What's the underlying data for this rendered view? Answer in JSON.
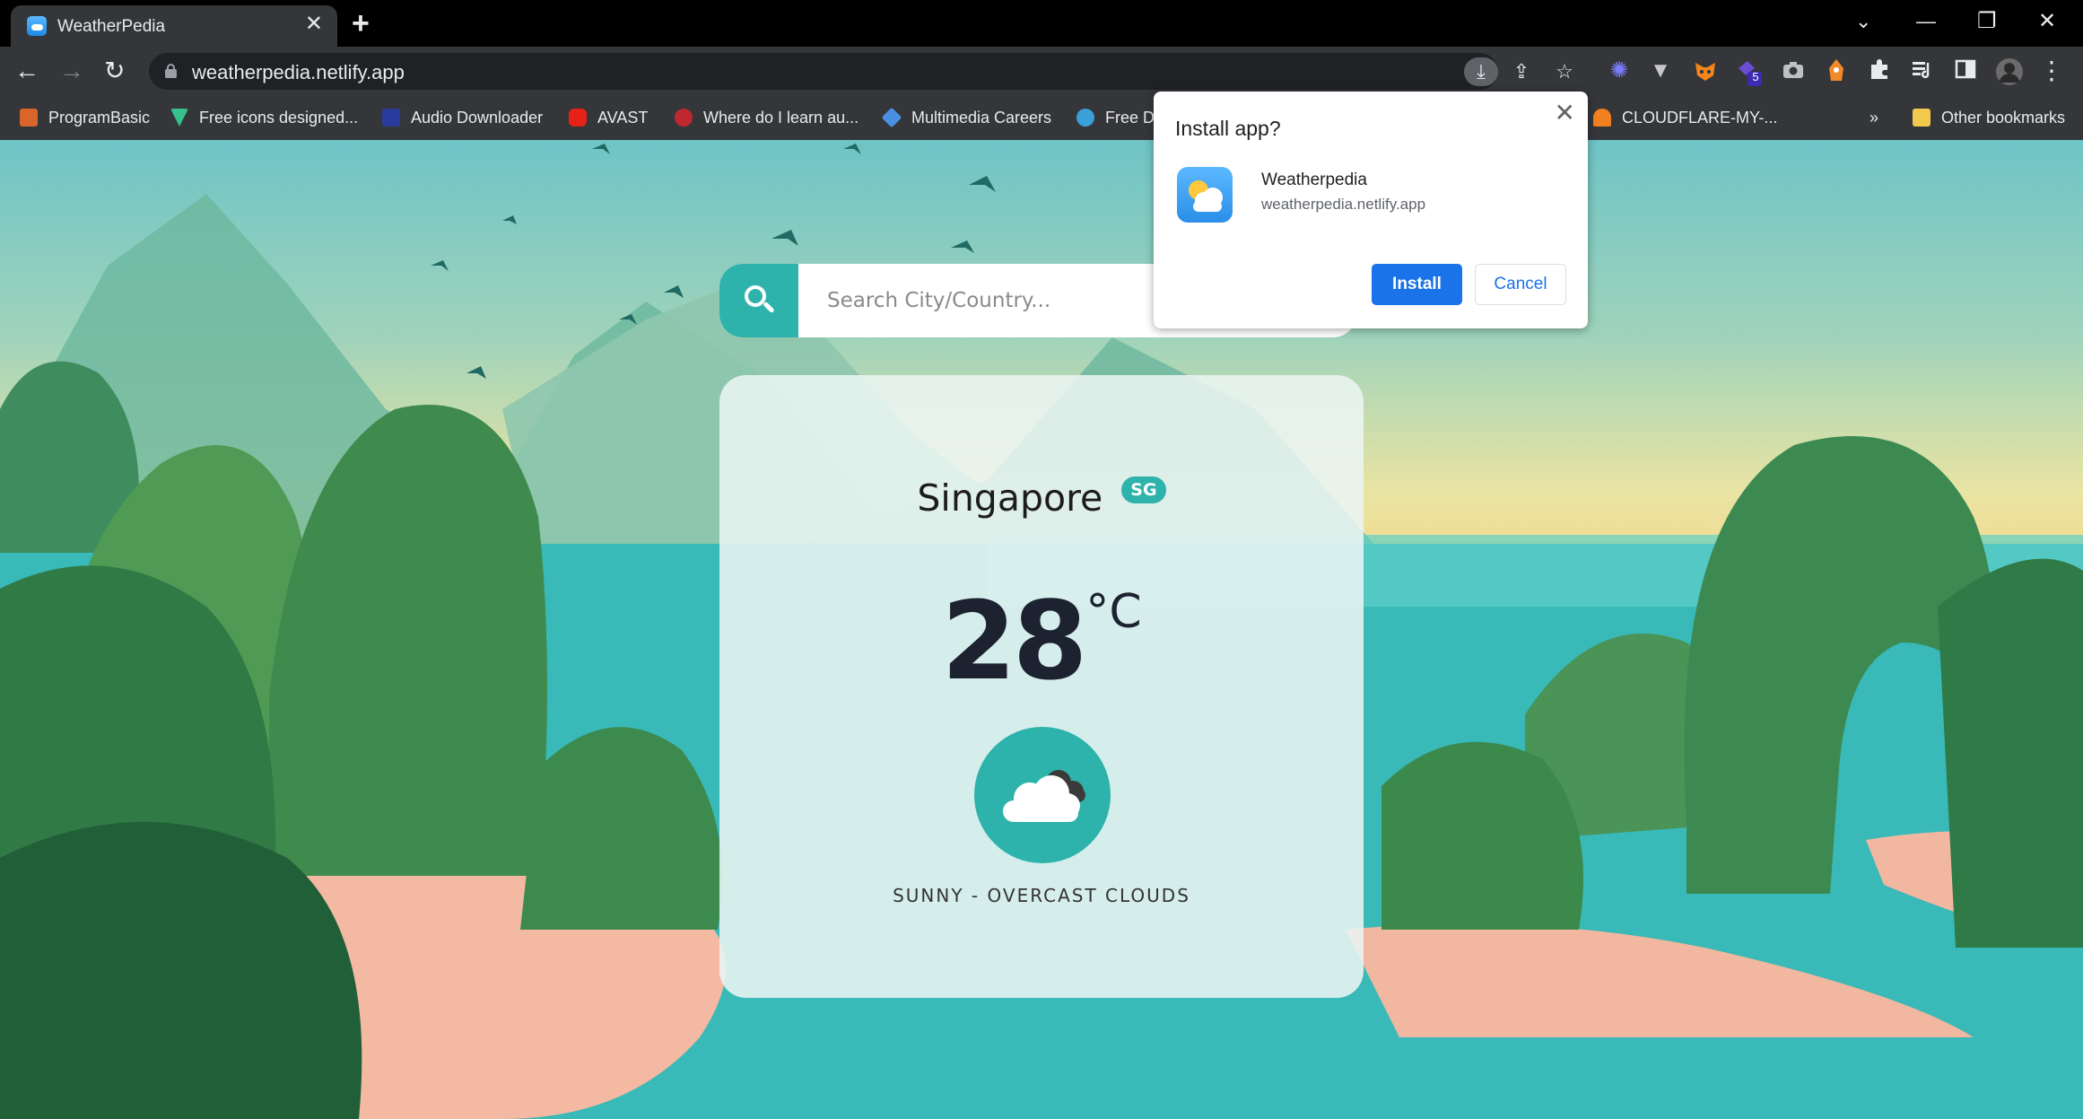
{
  "browser": {
    "tab": {
      "title": "WeatherPedia",
      "close_glyph": "✕"
    },
    "new_tab_glyph": "+",
    "window_controls": {
      "tablist": "⌄",
      "minimize": "—",
      "restore": "❐",
      "close": "✕"
    },
    "url": "weatherpedia.netlify.app",
    "nav": {
      "back": "←",
      "forward": "→",
      "reload": "↻"
    },
    "omnibox_icons": {
      "install": "⤓",
      "share": "⇪",
      "bookmark": "☆"
    },
    "extensions": {
      "badge_count": "5",
      "puzzle": "✱",
      "menu": "⋮"
    },
    "bookmarks": [
      {
        "label": "ProgramBasic",
        "color": "#d9652a"
      },
      {
        "label": "Free icons designed...",
        "color": "#36c28a"
      },
      {
        "label": "Audio Downloader",
        "color": "#2a3b9e"
      },
      {
        "label": "AVAST",
        "color": "#e62117"
      },
      {
        "label": "Where do I learn au...",
        "color": "#c0282f"
      },
      {
        "label": "Multimedia Careers",
        "color": "#4a90e2"
      },
      {
        "label": "Free D",
        "color": "#3aa0d8"
      },
      {
        "label": "CLOUDFLARE-MY-...",
        "color": "#f38020"
      }
    ],
    "bookmarks_overflow": "»",
    "other_bookmarks": "Other bookmarks"
  },
  "weather_app": {
    "search": {
      "placeholder": "Search City/Country..."
    },
    "city": "Singapore",
    "country_code": "SG",
    "temperature": "28",
    "unit": "°C",
    "condition": "SUNNY - OVERCAST CLOUDS",
    "icon": "cloud-icon",
    "accent_color": "#2db3ab"
  },
  "install_dialog": {
    "title": "Install app?",
    "app_name": "Weatherpedia",
    "app_url": "weatherpedia.netlify.app",
    "install_label": "Install",
    "cancel_label": "Cancel",
    "close_glyph": "✕"
  }
}
